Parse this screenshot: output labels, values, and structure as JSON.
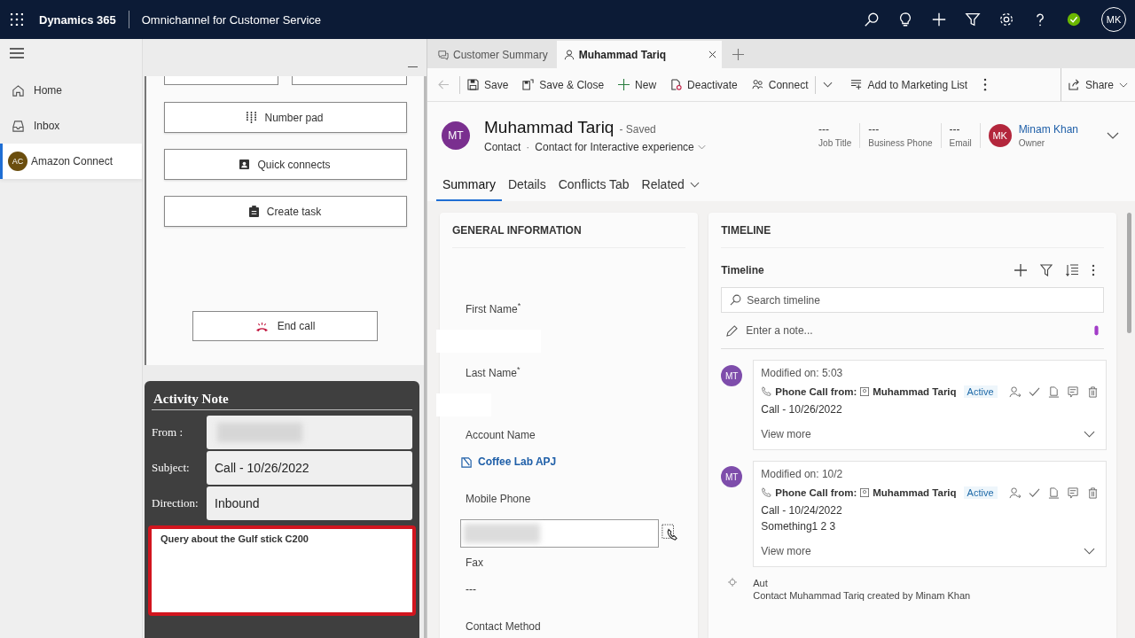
{
  "app_bar": {
    "app_name": "Dynamics 365",
    "area": "Omnichannel for Customer Service",
    "avatar": "MK"
  },
  "nav": [
    {
      "label": "Home",
      "kind": "home",
      "selected": false
    },
    {
      "label": "Inbox",
      "kind": "inbox",
      "selected": false
    },
    {
      "label": "Amazon Connect",
      "kind": "badge",
      "badge": "AC",
      "selected": true
    }
  ],
  "softphone": {
    "buttons": [
      {
        "label": "Number pad",
        "kind": "numpad"
      },
      {
        "label": "Quick connects",
        "kind": "contacts"
      },
      {
        "label": "Create task",
        "kind": "task"
      }
    ],
    "end_call": "End call",
    "activity_note": {
      "title": "Activity Note",
      "fields": [
        {
          "label": "From :",
          "kind": "blurred"
        },
        {
          "label": "Subject:",
          "kind": "text",
          "value": "Call - 10/26/2022"
        },
        {
          "label": "Direction:",
          "kind": "text",
          "value": "Inbound"
        }
      ],
      "note": "Query about the Gulf stick C200"
    }
  },
  "tabs": [
    {
      "label": "Customer Summary",
      "kind": "summary",
      "selected": false
    },
    {
      "label": "Muhammad Tariq",
      "kind": "person",
      "selected": true
    }
  ],
  "command_bar": [
    {
      "label": "Save",
      "kind": "save"
    },
    {
      "label": "Save & Close",
      "kind": "save-close"
    },
    {
      "label": "New",
      "kind": "new"
    },
    {
      "label": "Deactivate",
      "kind": "deactivate"
    },
    {
      "label": "Connect",
      "kind": "connect"
    },
    {
      "label": "Add to Marketing List",
      "kind": "list"
    }
  ],
  "share": "Share",
  "record": {
    "initials": "MT",
    "name": "Muhammad Tariq",
    "status": "- Saved",
    "entity": "Contact",
    "separator": "·",
    "form": "Contact for Interactive experience",
    "header_fields": [
      {
        "value": "---",
        "label": "Job Title"
      },
      {
        "value": "---",
        "label": "Business Phone"
      },
      {
        "value": "---",
        "label": "Email"
      }
    ],
    "owner": {
      "initials": "MK",
      "name": "Minam Khan",
      "role": "Owner"
    }
  },
  "form_tabs": [
    {
      "label": "Summary",
      "selected": true,
      "dropdown": false
    },
    {
      "label": "Details",
      "selected": false,
      "dropdown": false
    },
    {
      "label": "Conflicts Tab",
      "selected": false,
      "dropdown": false
    },
    {
      "label": "Related",
      "selected": false,
      "dropdown": true
    }
  ],
  "general": {
    "title": "GENERAL INFORMATION",
    "fields": [
      {
        "label": "First Name$^{*}$",
        "kind": "redacted"
      },
      {
        "label": "Last Name$^{*}$",
        "kind": "redacted"
      },
      {
        "label": "Account Name",
        "kind": "link",
        "value": "Coffee Lab APJ"
      },
      {
        "label": "Mobile Phone",
        "kind": "phone"
      },
      {
        "label": "Fax",
        "kind": "text",
        "value": "---"
      },
      {
        "label": "Contact Method",
        "kind": "none"
      }
    ]
  },
  "timeline": {
    "title": "TIMELINE",
    "header": "Timeline",
    "search_placeholder": "Search timeline",
    "note_placeholder": "Enter a note...",
    "entries": [
      {
        "avatar": "MT",
        "modified": "Modified on: 5:03",
        "title": "Phone Call from:",
        "contact": "Muhammad Tariq",
        "status": "Active",
        "lines": [
          "Call - 10/26/2022"
        ],
        "more": "View more"
      },
      {
        "avatar": "MT",
        "modified": "Modified on: 10/2",
        "title": "Phone Call from:",
        "contact": "Muhammad Tariq",
        "status": "Active",
        "lines": [
          "Call - 10/24/2022",
          "Something1 2 3"
        ],
        "more": "View more"
      }
    ],
    "auto": {
      "label": "Aut",
      "text": "Contact Muhammad Tariq created by Minam Khan"
    }
  }
}
